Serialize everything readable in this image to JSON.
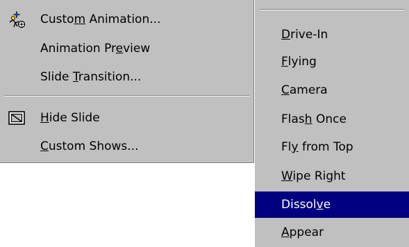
{
  "main_menu": {
    "items": [
      {
        "pre": "Custo",
        "key": "m",
        "post": " Animation...",
        "icon": "custom-animation-icon"
      },
      {
        "pre": "Animation Pr",
        "key": "e",
        "post": "view",
        "icon": ""
      },
      {
        "pre": "Slide ",
        "key": "T",
        "post": "ransition...",
        "icon": ""
      },
      {
        "pre": "",
        "key": "H",
        "post": "ide Slide",
        "icon": "hide-slide-icon"
      },
      {
        "pre": "",
        "key": "C",
        "post": "ustom Shows...",
        "icon": ""
      }
    ]
  },
  "sub_menu": {
    "selected_index": 6,
    "items": [
      {
        "pre": "",
        "key": "D",
        "post": "rive-In"
      },
      {
        "pre": "",
        "key": "F",
        "post": "lying"
      },
      {
        "pre": "",
        "key": "C",
        "post": "amera"
      },
      {
        "pre": "Flas",
        "key": "h",
        "post": " Once"
      },
      {
        "pre": "Fl",
        "key": "y",
        "post": " from Top"
      },
      {
        "pre": "",
        "key": "W",
        "post": "ipe Right"
      },
      {
        "pre": "Dissol",
        "key": "v",
        "post": "e"
      },
      {
        "pre": "",
        "key": "A",
        "post": "ppear"
      }
    ]
  },
  "colors": {
    "menu_face": "#c0c0c0",
    "highlight": "#000080",
    "highlight_text": "#ffffff",
    "shadow": "#808080"
  }
}
